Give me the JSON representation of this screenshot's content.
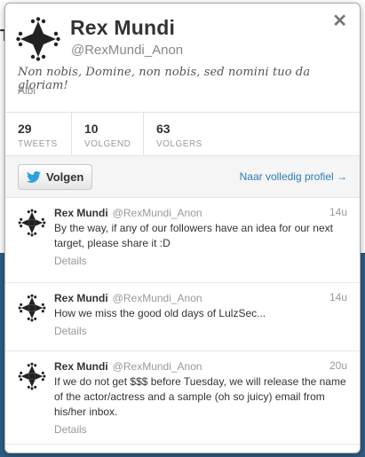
{
  "profile": {
    "name": "Rex Mundi",
    "handle": "@RexMundi_Anon",
    "bio": "Non nobis, Domine, non nobis, sed nomini tuo da gloriam!",
    "location": "Albi",
    "avatar_icon": "occitan-cross-icon"
  },
  "stats": [
    {
      "value": "29",
      "label": "TWEETS"
    },
    {
      "value": "10",
      "label": "VOLGEND"
    },
    {
      "value": "63",
      "label": "VOLGERS"
    }
  ],
  "actions": {
    "follow_label": "Volgen",
    "profile_link": "Naar volledig profiel →"
  },
  "tweets": [
    {
      "name": "Rex Mundi",
      "handle": "@RexMundi_Anon",
      "time": "14u",
      "text": "By the way, if any of our followers have an idea for our next target, please share it :D",
      "details": "Details"
    },
    {
      "name": "Rex Mundi",
      "handle": "@RexMundi_Anon",
      "time": "14u",
      "text": "How we miss the good old days of LulzSec...",
      "details": "Details"
    },
    {
      "name": "Rex Mundi",
      "handle": "@RexMundi_Anon",
      "time": "20u",
      "text": "If we do not get $$$ before Tuesday, we will release the name of the actor/actress and a sample (oh so juicy) email from his/her inbox.",
      "details": "Details"
    }
  ],
  "colors": {
    "link": "#2b7bb9",
    "backdrop": "#2f5d85"
  }
}
